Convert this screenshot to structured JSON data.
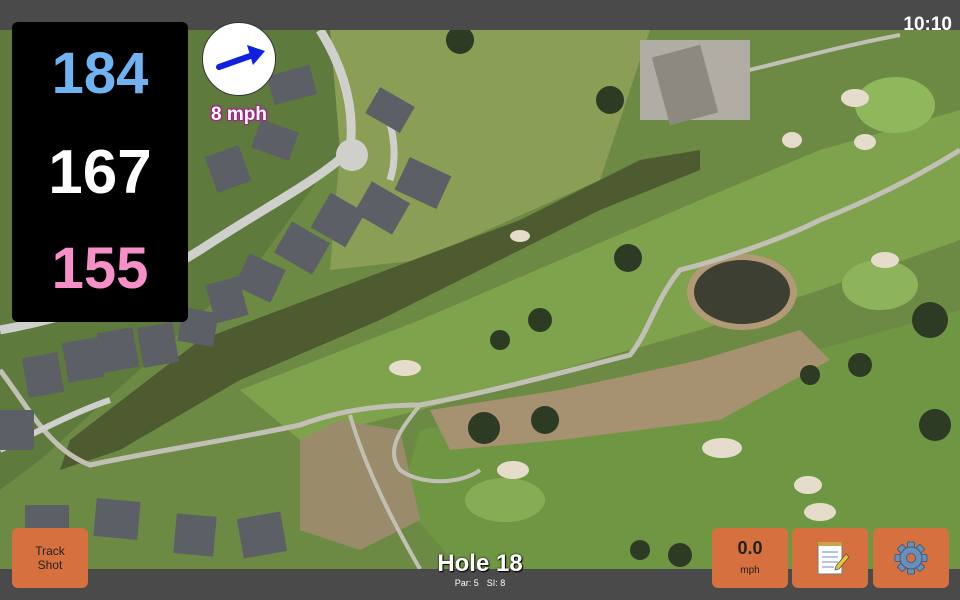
{
  "status_bar": {
    "time": "10:10"
  },
  "distances": {
    "back": "184",
    "middle": "167",
    "front": "155"
  },
  "wind": {
    "speed_label": "8 mph",
    "direction": "east-northeast",
    "arrow_color": "#1020e0"
  },
  "hole": {
    "title": "Hole 18",
    "par_label": "Par: 5",
    "si_label": "SI: 8"
  },
  "buttons": {
    "track_shot_line1": "Track",
    "track_shot_line2": "Shot",
    "wind_value": "0.0",
    "wind_unit": "mph",
    "notes_icon": "notepad-icon",
    "settings_icon": "gear-icon"
  },
  "colors": {
    "button_bg": "#d6703f",
    "back_distance": "#6fb3f3",
    "middle_distance": "#ffffff",
    "front_distance": "#f78fc8"
  }
}
